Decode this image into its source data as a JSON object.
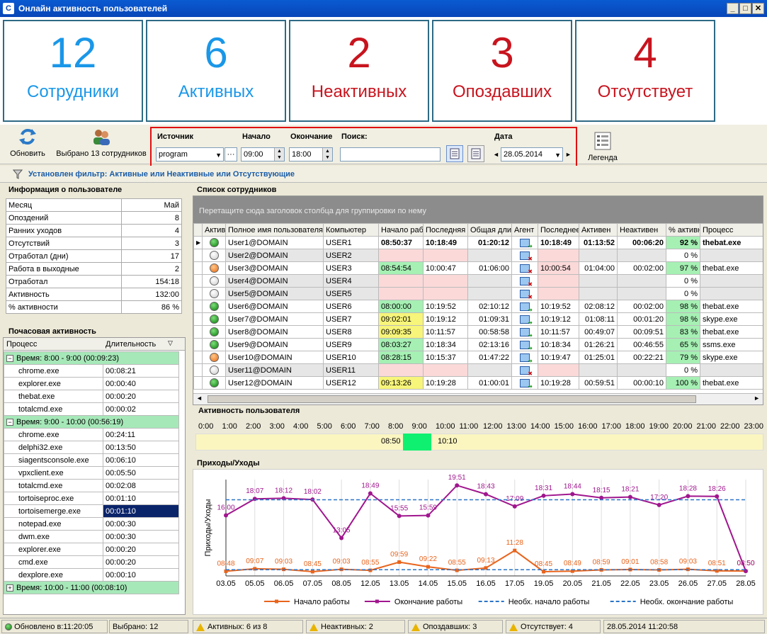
{
  "window": {
    "title": "Онлайн активность пользователей",
    "icon": "C"
  },
  "kpis": [
    {
      "value": "12",
      "label": "Сотрудники",
      "color": "#1a97e8"
    },
    {
      "value": "6",
      "label": "Активных",
      "color": "#1a97e8"
    },
    {
      "value": "2",
      "label": "Неактивных",
      "color": "#c8141e"
    },
    {
      "value": "3",
      "label": "Опоздавших",
      "color": "#c8141e"
    },
    {
      "value": "4",
      "label": "Отсутствует",
      "color": "#c8141e"
    }
  ],
  "toolbar": {
    "refresh": "Обновить",
    "selected": "Выбрано 13 сотрудников",
    "legend": "Легенда"
  },
  "filter": {
    "source_label": "Источник",
    "source_value": "program",
    "start_label": "Начало",
    "start_value": "09:00",
    "end_label": "Окончание",
    "end_value": "18:00",
    "search_label": "Поиск:",
    "search_value": "",
    "date_label": "Дата",
    "date_value": "28.05.2014"
  },
  "filterbar": {
    "text": "Установлен фильтр:  Активные или Неактивные или Отсутствующие"
  },
  "info_panel": {
    "title": "Информация о пользователе",
    "rows": [
      [
        "Месяц",
        "Май"
      ],
      [
        "Опоздений",
        "8"
      ],
      [
        "Ранних уходов",
        "4"
      ],
      [
        "Отсутствий",
        "3"
      ],
      [
        "Отработал (дни)",
        "17"
      ],
      [
        "Работа в выходные",
        "2"
      ],
      [
        "Отработал",
        "154:18"
      ],
      [
        "Активность",
        "132:00"
      ],
      [
        "% активности",
        "86 %"
      ]
    ]
  },
  "hourly_panel": {
    "title": "Почасовая активность",
    "col_process": "Процесс",
    "col_duration": "Длительность",
    "groups": [
      {
        "label": "Время: 8:00 - 9:00 (00:09:23)",
        "rows": [
          [
            "chrome.exe",
            "00:08:21"
          ],
          [
            "explorer.exe",
            "00:00:40"
          ],
          [
            "thebat.exe",
            "00:00:20"
          ],
          [
            "totalcmd.exe",
            "00:00:02"
          ]
        ]
      },
      {
        "label": "Время: 9:00 - 10:00 (00:56:19)",
        "rows": [
          [
            "chrome.exe",
            "00:24:11"
          ],
          [
            "delphi32.exe",
            "00:13:50"
          ],
          [
            "siagentsconsole.exe",
            "00:06:10"
          ],
          [
            "vpxclient.exe",
            "00:05:50"
          ],
          [
            "totalcmd.exe",
            "00:02:08"
          ],
          [
            "tortoiseproc.exe",
            "00:01:10"
          ],
          [
            "tortoisemerge.exe",
            "00:01:10"
          ],
          [
            "notepad.exe",
            "00:00:30"
          ],
          [
            "dwm.exe",
            "00:00:30"
          ],
          [
            "explorer.exe",
            "00:00:20"
          ],
          [
            "cmd.exe",
            "00:00:20"
          ],
          [
            "dexplore.exe",
            "00:00:10"
          ]
        ]
      },
      {
        "label": "Время: 10:00 - 11:00 (00:08:10)",
        "rows": []
      }
    ]
  },
  "employees_panel": {
    "title": "Список сотрудников",
    "group_hint": "Перетащите сюда заголовок столбца для группировки по нему",
    "columns": [
      "Активность",
      "Полное имя пользователя",
      "Компьютер",
      "Начало работы",
      "Последняя",
      "Общая длительность",
      "Агент",
      "Последнее",
      "Активен",
      "Неактивен",
      "% активности",
      "Процесс"
    ],
    "rows": [
      [
        "g",
        "User1@DOMAIN",
        "USER1",
        "08:50:37",
        "10:18:49",
        "01:20:12",
        "ok",
        "10:18:49",
        "01:13:52",
        "00:06:20",
        "92 %",
        "thebat.exe"
      ],
      [
        "w",
        "User2@DOMAIN",
        "USER2",
        "",
        "",
        "",
        "x",
        "",
        "",
        "",
        "0 %",
        ""
      ],
      [
        "o",
        "User3@DOMAIN",
        "USER3",
        "08:54:54",
        "10:00:47",
        "01:06:00",
        "x",
        "10:00:54",
        "01:04:00",
        "00:02:00",
        "97 %",
        "thebat.exe"
      ],
      [
        "w",
        "User4@DOMAIN",
        "USER4",
        "",
        "",
        "",
        "x",
        "",
        "",
        "",
        "0 %",
        ""
      ],
      [
        "w",
        "User5@DOMAIN",
        "USER5",
        "",
        "",
        "",
        "x",
        "",
        "",
        "",
        "0 %",
        ""
      ],
      [
        "g",
        "User6@DOMAIN",
        "USER6",
        "08:00:00",
        "10:19:52",
        "02:10:12",
        "ok",
        "10:19:52",
        "02:08:12",
        "00:02:00",
        "98 %",
        "thebat.exe"
      ],
      [
        "g",
        "User7@DOMAIN",
        "USER7",
        "09:02:01",
        "10:19:12",
        "01:09:31",
        "ok",
        "10:19:12",
        "01:08:11",
        "00:01:20",
        "98 %",
        "skype.exe"
      ],
      [
        "g",
        "User8@DOMAIN",
        "USER8",
        "09:09:35",
        "10:11:57",
        "00:58:58",
        "ok",
        "10:11:57",
        "00:49:07",
        "00:09:51",
        "83 %",
        "thebat.exe"
      ],
      [
        "g",
        "User9@DOMAIN",
        "USER9",
        "08:03:27",
        "10:18:34",
        "02:13:16",
        "ok",
        "10:18:34",
        "01:26:21",
        "00:46:55",
        "65 %",
        "ssms.exe"
      ],
      [
        "o",
        "User10@DOMAIN",
        "USER10",
        "08:28:15",
        "10:15:37",
        "01:47:22",
        "ok",
        "10:19:47",
        "01:25:01",
        "00:22:21",
        "79 %",
        "skype.exe"
      ],
      [
        "w",
        "User11@DOMAIN",
        "USER11",
        "",
        "",
        "",
        "x",
        "",
        "",
        "",
        "0 %",
        ""
      ],
      [
        "g",
        "User12@DOMAIN",
        "USER12",
        "09:13:26",
        "10:19:28",
        "01:00:01",
        "ok",
        "10:19:28",
        "00:59:51",
        "00:00:10",
        "100 %",
        "thebat.exe"
      ]
    ]
  },
  "activity_panel": {
    "title": "Активность пользователя",
    "hours": [
      "0:00",
      "1:00",
      "2:00",
      "3:00",
      "4:00",
      "5:00",
      "6:00",
      "7:00",
      "8:00",
      "9:00",
      "10:00",
      "11:00",
      "12:00",
      "13:00",
      "14:00",
      "15:00",
      "16:00",
      "17:00",
      "18:00",
      "19:00",
      "20:00",
      "21:00",
      "22:00",
      "23:00"
    ],
    "start_label": "08:50",
    "end_label": "10:10"
  },
  "chart_panel": {
    "title": "Приходы/Уходы"
  },
  "chart_data": {
    "type": "line",
    "ylabel": "Приходы/Уходы",
    "categories": [
      "03.05",
      "05.05",
      "06.05",
      "07.05",
      "08.05",
      "12.05",
      "13.05",
      "14.05",
      "15.05",
      "16.05",
      "17.05",
      "19.05",
      "20.05",
      "21.05",
      "22.05",
      "23.05",
      "26.05",
      "27.05",
      "28.05"
    ],
    "series": [
      {
        "name": "Начало работы",
        "color": "#e8641c",
        "values": [
          8.8,
          9.12,
          9.05,
          8.75,
          9.05,
          8.92,
          9.98,
          9.37,
          8.92,
          9.22,
          11.47,
          8.75,
          8.82,
          8.98,
          9.02,
          8.97,
          9.05,
          8.85,
          8.83
        ],
        "labels": [
          "08:48",
          "09:07",
          "09:03",
          "08:45",
          "09:03",
          "08:55",
          "09:59",
          "09:22",
          "08:55",
          "09:13",
          "11:28",
          "08:45",
          "08:49",
          "08:59",
          "09:01",
          "08:58",
          "09:03",
          "08:51",
          "08:50"
        ]
      },
      {
        "name": "Окончание работы",
        "color": "#a0168e",
        "values": [
          16.0,
          18.12,
          18.2,
          18.03,
          13.08,
          18.82,
          15.92,
          15.98,
          19.85,
          18.72,
          17.15,
          18.52,
          18.73,
          18.25,
          18.35,
          17.33,
          18.47,
          18.43,
          8.83
        ],
        "labels": [
          "16:00",
          "18:07",
          "18:12",
          "18:02",
          "13:05",
          "18:49",
          "15:55",
          "15:59",
          "19:51",
          "18:43",
          "17:09",
          "18:31",
          "18:44",
          "18:15",
          "18:21",
          "17:20",
          "18:28",
          "18:26",
          "08:50"
        ]
      },
      {
        "name": "Необх. начало работы",
        "color": "#2a74c8",
        "dashed": true,
        "values": [
          9,
          9,
          9,
          9,
          9,
          9,
          9,
          9,
          9,
          9,
          9,
          9,
          9,
          9,
          9,
          9,
          9,
          9,
          9
        ]
      },
      {
        "name": "Необх. окончание работы",
        "color": "#2a74c8",
        "dashed": true,
        "values": [
          18,
          18,
          18,
          18,
          18,
          18,
          18,
          18,
          18,
          18,
          18,
          18,
          18,
          18,
          18,
          18,
          18,
          18,
          18
        ]
      }
    ],
    "ylim": [
      8.2,
      20.6
    ],
    "legend": "bottom"
  },
  "statusbar": {
    "updated": "Обновлено в:11:20:05",
    "selected": "Выбрано: 12",
    "active": "Активных: 6 из 8",
    "inactive": "Неактивных: 2",
    "late": "Опоздавших: 3",
    "absent": "Отсутствует: 4",
    "datetime": "28.05.2014 11:20:58"
  }
}
